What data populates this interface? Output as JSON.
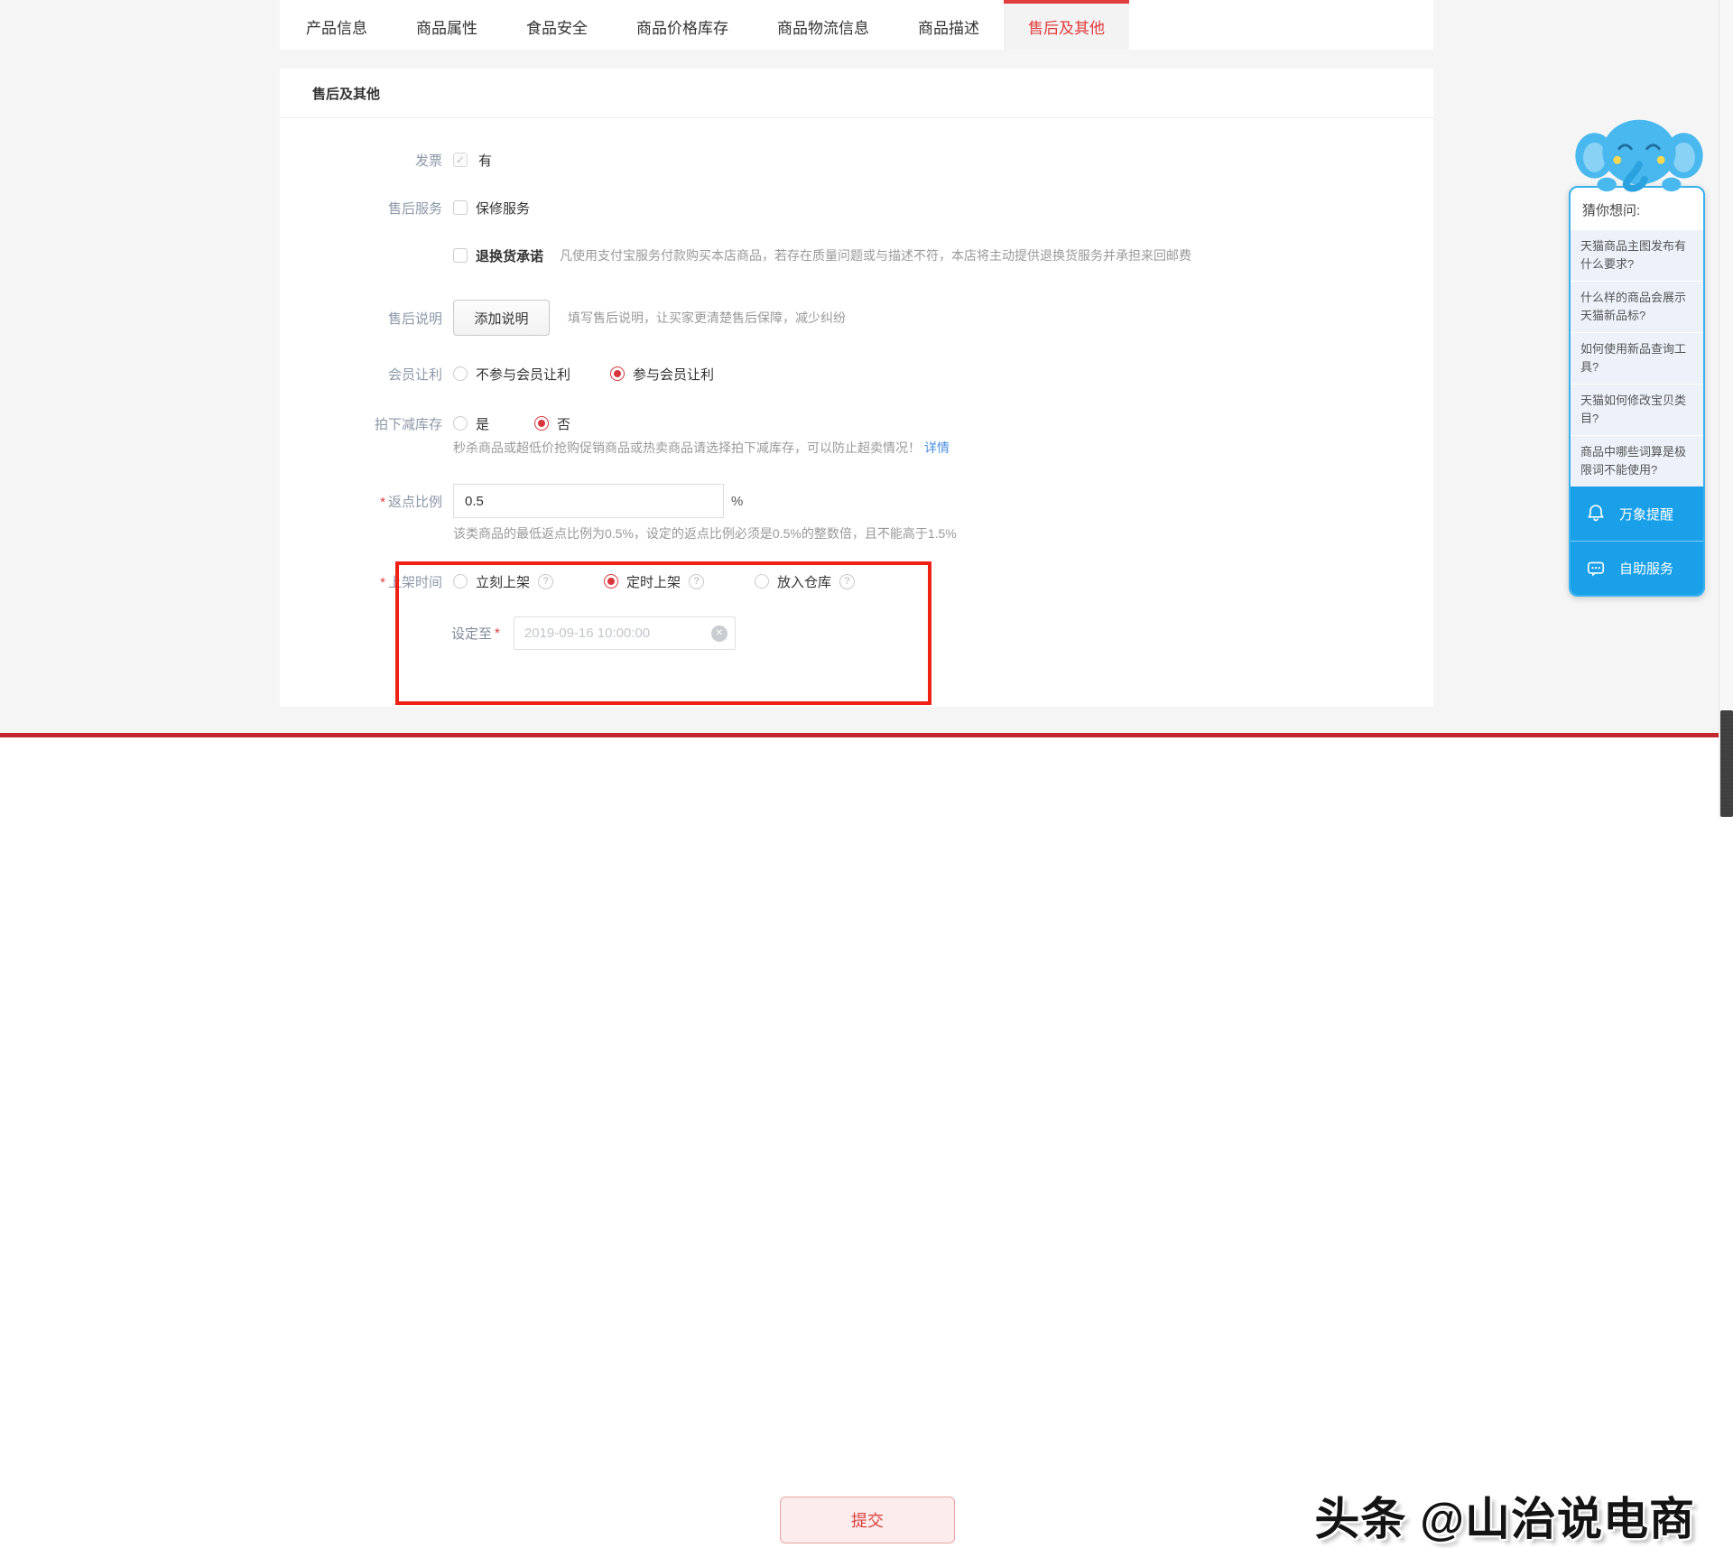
{
  "tabs": {
    "items": [
      {
        "label": "产品信息"
      },
      {
        "label": "商品属性"
      },
      {
        "label": "食品安全"
      },
      {
        "label": "商品价格库存"
      },
      {
        "label": "商品物流信息"
      },
      {
        "label": "商品描述"
      },
      {
        "label": "售后及其他",
        "active": true
      }
    ]
  },
  "panel_title": "售后及其他",
  "form": {
    "invoice": {
      "label": "发票",
      "value": "有",
      "checked": true
    },
    "service": {
      "label": "售后服务",
      "warranty": "保修服务",
      "checked": false
    },
    "return_promise": {
      "title": "退换货承诺",
      "checked": false,
      "desc": "凡使用支付宝服务付款购买本店商品，若存在质量问题或与描述不符，本店将主动提供退换货服务并承担来回邮费"
    },
    "note": {
      "label": "售后说明",
      "button": "添加说明",
      "hint": "填写售后说明，让买家更清楚售后保障，减少纠纷"
    },
    "member": {
      "label": "会员让利",
      "opt_no": "不参与会员让利",
      "opt_yes": "参与会员让利",
      "selected": "参与会员让利"
    },
    "stock": {
      "label": "拍下减库存",
      "opt_yes": "是",
      "opt_no": "否",
      "selected": "否",
      "hint": "秒杀商品或超低价抢购促销商品或热卖商品请选择拍下减库存，可以防止超卖情况！",
      "link": "详情"
    },
    "rebate": {
      "required_mark": "*",
      "label": "返点比例",
      "value": "0.5",
      "unit": "%",
      "hint": "该类商品的最低返点比例为0.5%，设定的返点比例必须是0.5%的整数倍，且不能高于1.5%"
    },
    "launch": {
      "required_mark": "*",
      "label": "上架时间",
      "opt1": "立刻上架",
      "opt2": "定时上架",
      "opt3": "放入仓库",
      "selected": "定时上架"
    },
    "schedule": {
      "label": "设定至",
      "required_mark": "*",
      "value": "2019-09-16 10:00:00"
    }
  },
  "submit_label": "提交",
  "help": {
    "title": "猜你想问:",
    "questions": [
      "天猫商品主图发布有什么要求?",
      "什么样的商品会展示天猫新品标?",
      "如何使用新品查询工具?",
      "天猫如何修改宝贝类目?",
      "商品中哪些词算是极限词不能使用?"
    ],
    "action1": "万象提醒",
    "action2": "自助服务"
  },
  "watermark": "头条 @山治说电商",
  "icons": {
    "help": "?",
    "clear": "✕",
    "check": "✓"
  },
  "colors": {
    "accent_red": "#e23b3b",
    "annotation_red": "#ee2114",
    "line_red": "#c1272d",
    "link_blue": "#4a8fe2",
    "widget_blue": "#1aa0e8",
    "widget_border_blue": "#38b1ef",
    "selected_radio_red": "#d9363c"
  }
}
